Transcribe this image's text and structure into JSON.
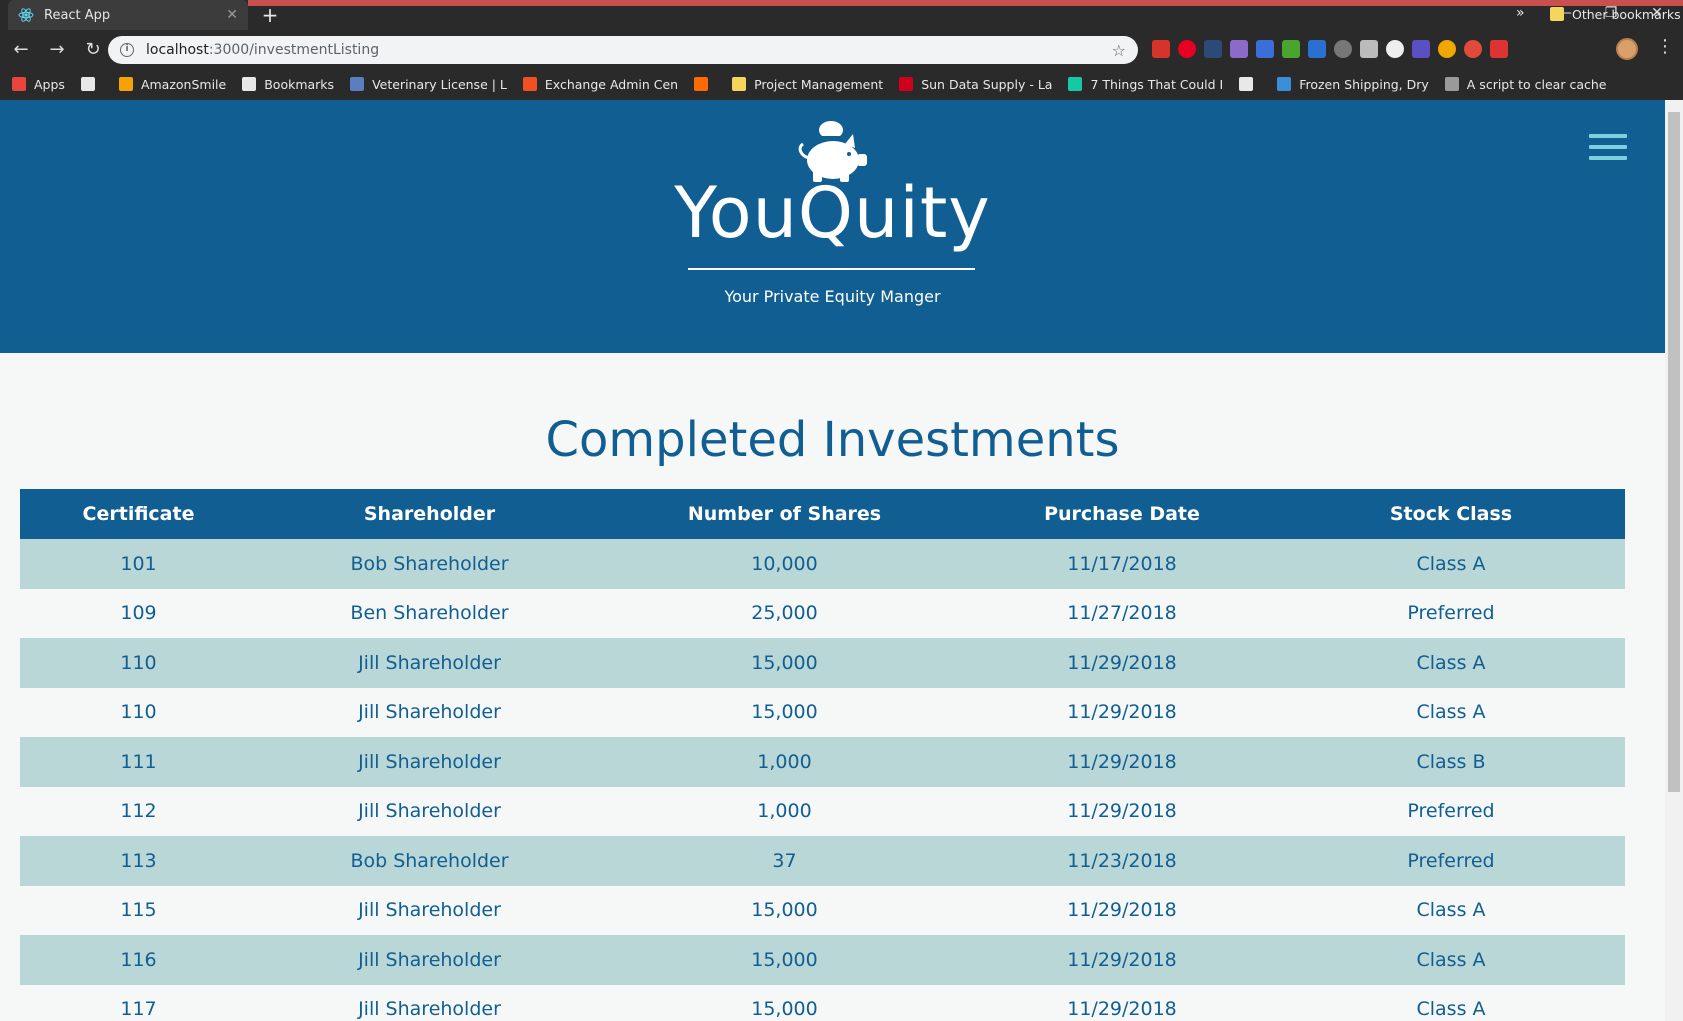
{
  "browser": {
    "tab_title": "React App",
    "url_host": "localhost",
    "url_path": ":3000/investmentListing",
    "bookmarks": [
      {
        "label": "Apps",
        "icon": "apps-grid-icon",
        "color": "#e8453c"
      },
      {
        "label": "",
        "icon": "page-icon",
        "color": "#e8e8e8"
      },
      {
        "label": "AmazonSmile",
        "icon": "amazon-icon",
        "color": "#f4a300"
      },
      {
        "label": "Bookmarks",
        "icon": "star-icon",
        "color": "#e8e8e8"
      },
      {
        "label": "Veterinary License | L",
        "icon": "paw-icon",
        "color": "#5a7fbf"
      },
      {
        "label": "Exchange Admin Cen",
        "icon": "microsoft-icon",
        "color": "#f25022"
      },
      {
        "label": "",
        "icon": "ars-icon",
        "color": "#ff6b00"
      },
      {
        "label": "Project Management",
        "icon": "folder-icon",
        "color": "#f6d55c"
      },
      {
        "label": "Sun Data Supply - La",
        "icon": "s-icon",
        "color": "#d0021b"
      },
      {
        "label": "7 Things That Could I",
        "icon": "arrow-circle-icon",
        "color": "#16c9a6"
      },
      {
        "label": "",
        "icon": "page-icon",
        "color": "#e8e8e8"
      },
      {
        "label": "Frozen Shipping, Dry",
        "icon": "circle-icon",
        "color": "#3b8ed8"
      },
      {
        "label": "A script to clear cache",
        "icon": "404-icon",
        "color": "#9a9a9a"
      }
    ],
    "other_bookmarks": "Other bookmarks",
    "more": "»"
  },
  "header": {
    "brand": "YouQuity",
    "tagline": "Your Private Equity Manger"
  },
  "main": {
    "title": "Completed Investments",
    "columns": [
      "Certificate",
      "Shareholder",
      "Number of Shares",
      "Purchase Date",
      "Stock Class"
    ],
    "rows": [
      [
        "101",
        "Bob Shareholder",
        "10,000",
        "11/17/2018",
        "Class A"
      ],
      [
        "109",
        "Ben Shareholder",
        "25,000",
        "11/27/2018",
        "Preferred"
      ],
      [
        "110",
        "Jill Shareholder",
        "15,000",
        "11/29/2018",
        "Class A"
      ],
      [
        "110",
        "Jill Shareholder",
        "15,000",
        "11/29/2018",
        "Class A"
      ],
      [
        "111",
        "Jill Shareholder",
        "1,000",
        "11/29/2018",
        "Class B"
      ],
      [
        "112",
        "Jill Shareholder",
        "1,000",
        "11/29/2018",
        "Preferred"
      ],
      [
        "113",
        "Bob Shareholder",
        "37",
        "11/23/2018",
        "Preferred"
      ],
      [
        "115",
        "Jill Shareholder",
        "15,000",
        "11/29/2018",
        "Class A"
      ],
      [
        "116",
        "Jill Shareholder",
        "15,000",
        "11/29/2018",
        "Class A"
      ],
      [
        "117",
        "Jill Shareholder",
        "15,000",
        "11/29/2018",
        "Class A"
      ]
    ]
  },
  "colors": {
    "brand_blue": "#115e93",
    "row_tint": "#b9d7d6",
    "hamburger": "#7fd0de"
  }
}
